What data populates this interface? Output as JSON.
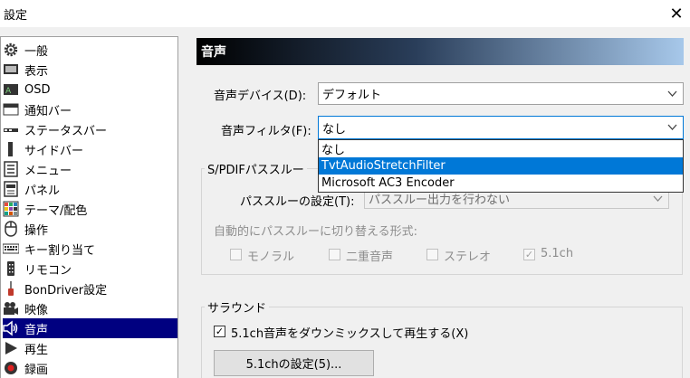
{
  "window": {
    "title": "設定",
    "close_glyph": "✕"
  },
  "sidebar": {
    "items": [
      {
        "label": "一般",
        "icon": "gear-icon"
      },
      {
        "label": "表示",
        "icon": "display-icon"
      },
      {
        "label": "OSD",
        "icon": "osd-icon"
      },
      {
        "label": "通知バー",
        "icon": "notification-bar-icon"
      },
      {
        "label": "ステータスバー",
        "icon": "status-bar-icon"
      },
      {
        "label": "サイドバー",
        "icon": "side-bar-icon"
      },
      {
        "label": "メニュー",
        "icon": "menu-icon"
      },
      {
        "label": "パネル",
        "icon": "panel-icon"
      },
      {
        "label": "テーマ/配色",
        "icon": "theme-icon"
      },
      {
        "label": "操作",
        "icon": "mouse-icon"
      },
      {
        "label": "キー割り当て",
        "icon": "keyboard-icon"
      },
      {
        "label": "リモコン",
        "icon": "remote-icon"
      },
      {
        "label": "BonDriver設定",
        "icon": "bondriver-icon"
      },
      {
        "label": "映像",
        "icon": "camera-icon"
      },
      {
        "label": "音声",
        "icon": "speaker-icon"
      },
      {
        "label": "再生",
        "icon": "play-icon"
      },
      {
        "label": "録画",
        "icon": "record-icon"
      }
    ],
    "selected": "音声"
  },
  "panel": {
    "title": "音声",
    "device_label": "音声デバイス(D):",
    "device_value": "デフォルト",
    "filter_label": "音声フィルタ(F):",
    "filter_value": "なし",
    "filter_options": [
      "なし",
      "TvtAudioStretchFilter",
      "Microsoft AC3 Encoder"
    ],
    "filter_highlighted": "TvtAudioStretchFilter",
    "spdif": {
      "title": "S/PDIFパススルー",
      "passthrough_label": "パススルーの設定(T):",
      "passthrough_value": "パススルー出力を行わない",
      "auto_label": "自動的にパススルーに切り替える形式:",
      "options": [
        {
          "label": "モノラル",
          "checked": false
        },
        {
          "label": "二重音声",
          "checked": false
        },
        {
          "label": "ステレオ",
          "checked": false
        },
        {
          "label": "5.1ch",
          "checked": true
        }
      ]
    },
    "surround": {
      "title": "サラウンド",
      "downmix_label": "5.1ch音声をダウンミックスして再生する(X)",
      "downmix_checked": true,
      "settings_button": "5.1chの設定(5)..."
    }
  }
}
